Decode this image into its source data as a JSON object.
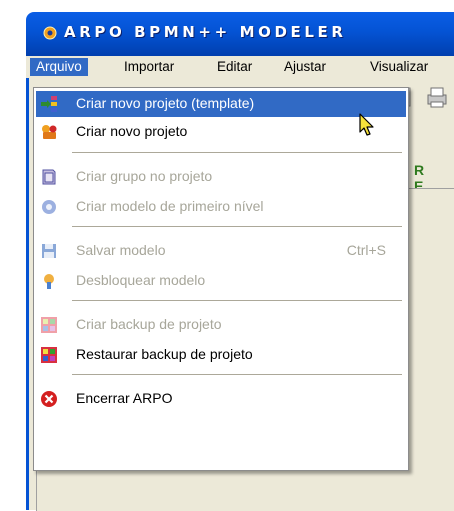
{
  "window": {
    "title": "ARPO BPMN++ MODELER"
  },
  "menubar": {
    "items": [
      "Arquivo",
      "Importar",
      "Editar",
      "Ajustar",
      "Visualizar"
    ]
  },
  "toolbar": {
    "partial_text": "R E"
  },
  "menu": {
    "items": [
      {
        "label": "Criar novo projeto (template)",
        "icon": "template-project-icon",
        "state": "highlighted"
      },
      {
        "label": "Criar novo projeto",
        "icon": "new-project-icon",
        "state": "enabled"
      },
      {
        "label": "Criar grupo no projeto",
        "icon": "group-folder-icon",
        "state": "disabled"
      },
      {
        "label": "Criar modelo de primeiro nível",
        "icon": "first-level-model-icon",
        "state": "disabled"
      },
      {
        "label": "Salvar modelo",
        "shortcut": "Ctrl+S",
        "icon": "save-icon",
        "state": "disabled"
      },
      {
        "label": "Desbloquear modelo",
        "icon": "unlock-icon",
        "state": "disabled"
      },
      {
        "label": "Criar backup de projeto",
        "icon": "backup-icon",
        "state": "disabled"
      },
      {
        "label": "Restaurar backup de projeto",
        "icon": "restore-backup-icon",
        "state": "enabled"
      },
      {
        "label": "Encerrar ARPO",
        "icon": "exit-icon",
        "state": "enabled"
      }
    ]
  },
  "colors": {
    "highlight": "#316ac5",
    "titlebar": "#0453d4",
    "disabled_text": "#a7a69a",
    "menubar": "#ece9d8"
  }
}
